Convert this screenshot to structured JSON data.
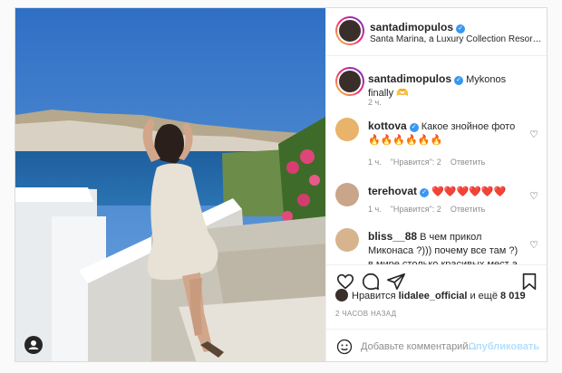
{
  "post": {
    "author": "santadimopulos",
    "location": "Santa Marina, a Luxury Collection Resort, Myk…",
    "caption": "Mykonos finally 🫶",
    "caption_time": "2 ч."
  },
  "comments": [
    {
      "user": "kottova",
      "text": "Какое знойное фото 🔥🔥🔥🔥🔥🔥",
      "time": "1 ч.",
      "likes": "\"Нравится\": 2",
      "reply": "Ответить"
    },
    {
      "user": "terehovat",
      "text": "❤️❤️❤️❤️❤️❤️",
      "time": "1 ч.",
      "likes": "\"Нравится\": 2",
      "reply": "Ответить"
    },
    {
      "user": "bliss__88",
      "text": "В чем прикол Миконаса ?))) почему все там ?) в мире столько красивых мест а весь",
      "time": "",
      "likes": "",
      "reply": ""
    }
  ],
  "likes": {
    "prefix": "Нравится",
    "user": "lidalee_official",
    "suffix": "и ещё",
    "count": "8 019"
  },
  "timestamp": "2 ЧАСОВ НАЗАД",
  "add_comment": {
    "placeholder": "Добавьте комментарий...",
    "publish": "Опубликовать"
  },
  "colors": {
    "verified": "#3897f0",
    "publish": "#b2dffc",
    "muted": "#8e8e8e"
  }
}
